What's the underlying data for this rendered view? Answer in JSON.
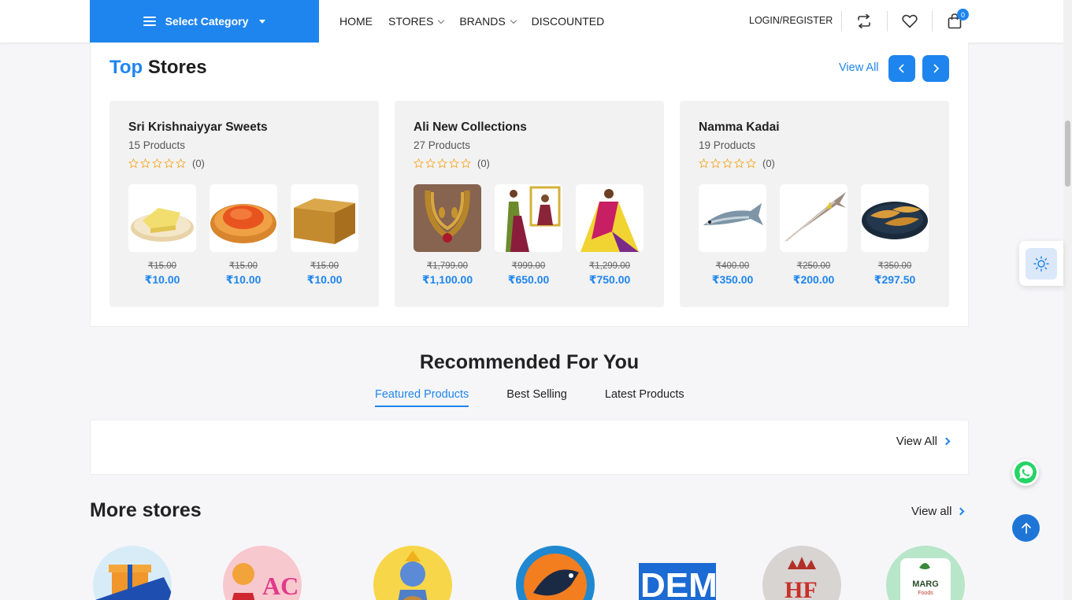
{
  "header": {
    "category_label": "Select Category",
    "nav": [
      {
        "label": "HOME",
        "dropdown": false
      },
      {
        "label": "STORES",
        "dropdown": true
      },
      {
        "label": "BRANDS",
        "dropdown": true
      },
      {
        "label": "DISCOUNTED",
        "dropdown": false
      }
    ],
    "login_label": "LOGIN/REGISTER",
    "cart_count": "0",
    "icons": [
      "compare-icon",
      "wishlist-heart-icon",
      "cart-bag-icon"
    ]
  },
  "top_stores": {
    "title_accent": "Top",
    "title_rest": " Stores",
    "view_all": "View All",
    "stores": [
      {
        "name": "Sri Krishnaiyyar Sweets",
        "products_count": "15 Products",
        "rating_count": "(0)",
        "products": [
          {
            "image": "yellow-sweet-barfi",
            "old_price": "₹15.00",
            "new_price": "₹10.00"
          },
          {
            "image": "orange-sweet-gujiya",
            "old_price": "₹15.00",
            "new_price": "₹10.00"
          },
          {
            "image": "jaggery-block",
            "old_price": "₹15.00",
            "new_price": "₹10.00"
          }
        ]
      },
      {
        "name": "Ali New Collections",
        "products_count": "27 Products",
        "rating_count": "(0)",
        "products": [
          {
            "image": "gold-necklace-set",
            "old_price": "₹1,799.00",
            "new_price": "₹1,100.00"
          },
          {
            "image": "green-saree",
            "old_price": "₹999.00",
            "new_price": "₹650.00"
          },
          {
            "image": "yellow-saree",
            "old_price": "₹1,299.00",
            "new_price": "₹750.00"
          }
        ]
      },
      {
        "name": "Namma Kadai",
        "products_count": "19 Products",
        "rating_count": "(0)",
        "products": [
          {
            "image": "mackerel-fish",
            "old_price": "₹400.00",
            "new_price": "₹350.00"
          },
          {
            "image": "barracuda-fish",
            "old_price": "₹250.00",
            "new_price": "₹200.00"
          },
          {
            "image": "fried-fish-plate",
            "old_price": "₹350.00",
            "new_price": "₹297.50"
          }
        ]
      }
    ]
  },
  "recommended": {
    "title": "Recommended For You",
    "tabs": [
      {
        "label": "Featured Products",
        "active": true
      },
      {
        "label": "Best Selling",
        "active": false
      },
      {
        "label": "Latest Products",
        "active": false
      }
    ],
    "view_all": "View All"
  },
  "more_stores": {
    "title": "More stores",
    "view_all": "View all",
    "logos": [
      "gift-store-logo",
      "ac-store-logo",
      "krishna-store-logo",
      "namma-fish-logo",
      "demo-store-logo",
      "hf-store-logo"
    ],
    "marg_logo_text": [
      "MARG",
      "Foods"
    ]
  },
  "colors": {
    "accent": "#1f85ee",
    "star": "#f5a623"
  }
}
